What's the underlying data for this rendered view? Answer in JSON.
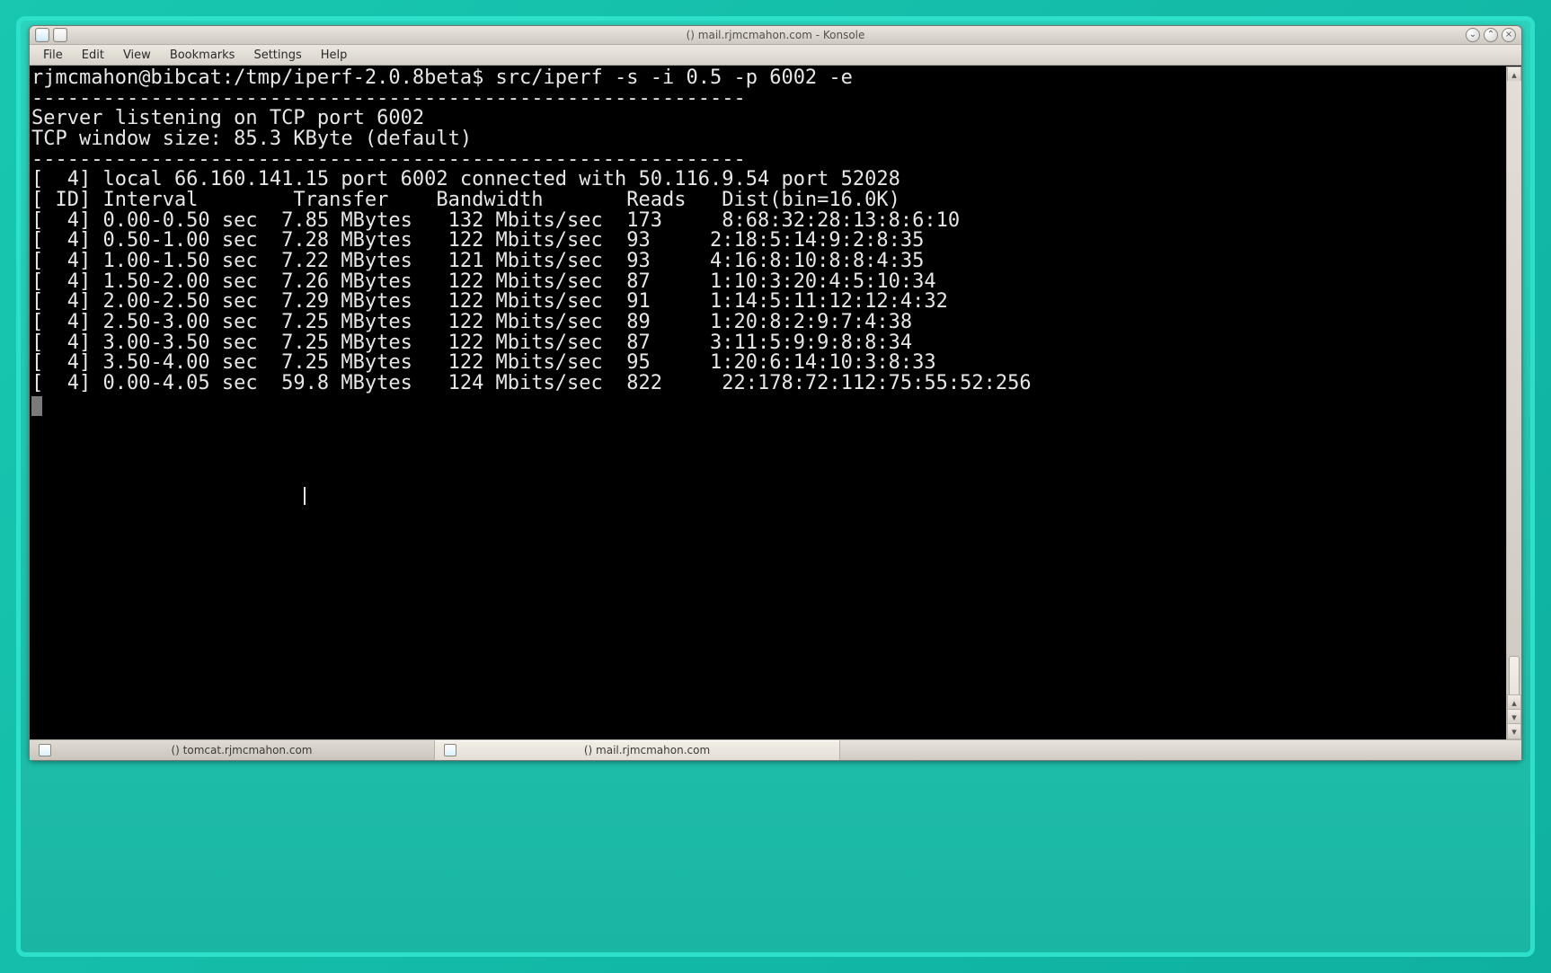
{
  "window": {
    "title": "() mail.rjmcmahon.com - Konsole"
  },
  "menubar": [
    "File",
    "Edit",
    "View",
    "Bookmarks",
    "Settings",
    "Help"
  ],
  "terminal": {
    "prompt": "rjmcmahon@bibcat:/tmp/iperf-2.0.8beta$ ",
    "command": "src/iperf -s -i 0.5 -p 6002 -e",
    "sep": "------------------------------------------------------------",
    "listen": "Server listening on TCP port 6002",
    "winsize": "TCP window size: 85.3 KByte (default)",
    "connected": "[  4] local 66.160.141.15 port 6002 connected with 50.116.9.54 port 52028",
    "header": "[ ID] Interval        Transfer    Bandwidth       Reads   Dist(bin=16.0K)",
    "rows": [
      "[  4] 0.00-0.50 sec  7.85 MBytes   132 Mbits/sec  173     8:68:32:28:13:8:6:10",
      "[  4] 0.50-1.00 sec  7.28 MBytes   122 Mbits/sec  93     2:18:5:14:9:2:8:35",
      "[  4] 1.00-1.50 sec  7.22 MBytes   121 Mbits/sec  93     4:16:8:10:8:8:4:35",
      "[  4] 1.50-2.00 sec  7.26 MBytes   122 Mbits/sec  87     1:10:3:20:4:5:10:34",
      "[  4] 2.00-2.50 sec  7.29 MBytes   122 Mbits/sec  91     1:14:5:11:12:12:4:32",
      "[  4] 2.50-3.00 sec  7.25 MBytes   122 Mbits/sec  89     1:20:8:2:9:7:4:38",
      "[  4] 3.00-3.50 sec  7.25 MBytes   122 Mbits/sec  87     3:11:5:9:9:8:8:34",
      "[  4] 3.50-4.00 sec  7.25 MBytes   122 Mbits/sec  95     1:20:6:14:10:3:8:33",
      "[  4] 0.00-4.05 sec  59.8 MBytes   124 Mbits/sec  822     22:178:72:112:75:55:52:256"
    ]
  },
  "tabs": [
    {
      "label": "() tomcat.rjmcmahon.com",
      "active": false
    },
    {
      "label": "() mail.rjmcmahon.com",
      "active": true
    }
  ]
}
